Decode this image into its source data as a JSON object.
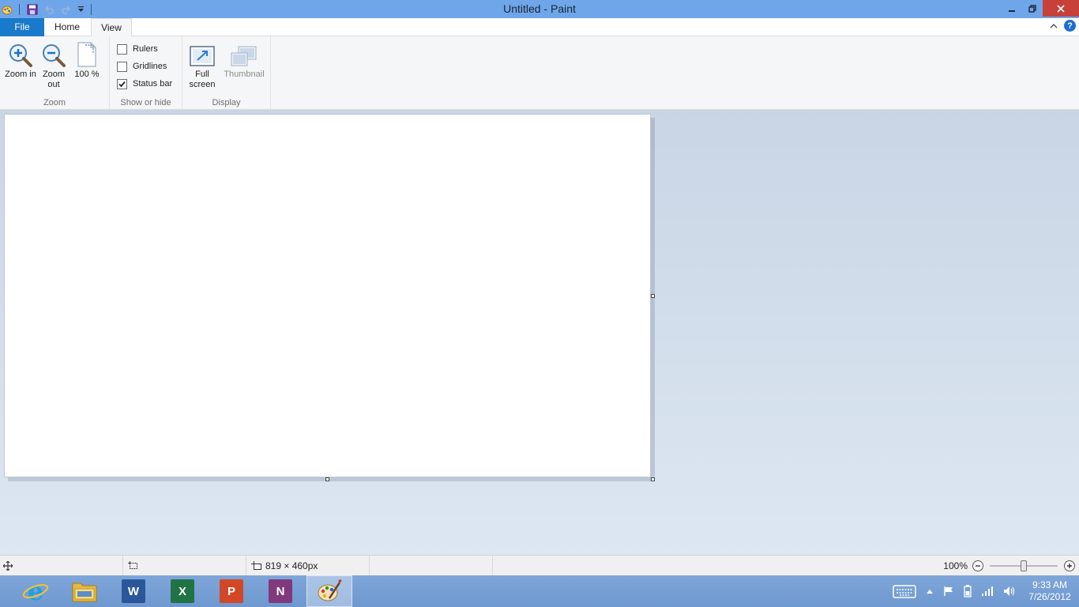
{
  "window": {
    "title": "Untitled - Paint"
  },
  "tabs": {
    "file": "File",
    "home": "Home",
    "view": "View"
  },
  "ribbon": {
    "zoom_group": {
      "label": "Zoom",
      "zoom_in": "Zoom in",
      "zoom_out": "Zoom out",
      "hundred": "100 %"
    },
    "show_hide_group": {
      "label": "Show or hide",
      "rulers": "Rulers",
      "gridlines": "Gridlines",
      "status_bar": "Status bar",
      "rulers_checked": false,
      "gridlines_checked": false,
      "status_bar_checked": true
    },
    "display_group": {
      "label": "Display",
      "full_screen": "Full screen",
      "thumbnail": "Thumbnail"
    }
  },
  "statusbar": {
    "canvas_size": "819 × 460px",
    "zoom_percent": "100%",
    "zoom_level": 0.5
  },
  "taskbar": {
    "apps": [
      "internet-explorer",
      "file-explorer",
      "word",
      "excel",
      "powerpoint",
      "onenote",
      "paint"
    ],
    "word_letter": "W",
    "excel_letter": "X",
    "powerpoint_letter": "P",
    "onenote_letter": "N",
    "time": "9:33 AM",
    "date": "7/26/2012"
  },
  "colors": {
    "titlebar": "#6fa6ea",
    "file_tab": "#1979ca",
    "close_button": "#c7413a",
    "taskbar": "#7fa6d9",
    "word": "#2b579a",
    "excel": "#217346",
    "powerpoint": "#d24726",
    "onenote": "#80397b"
  }
}
